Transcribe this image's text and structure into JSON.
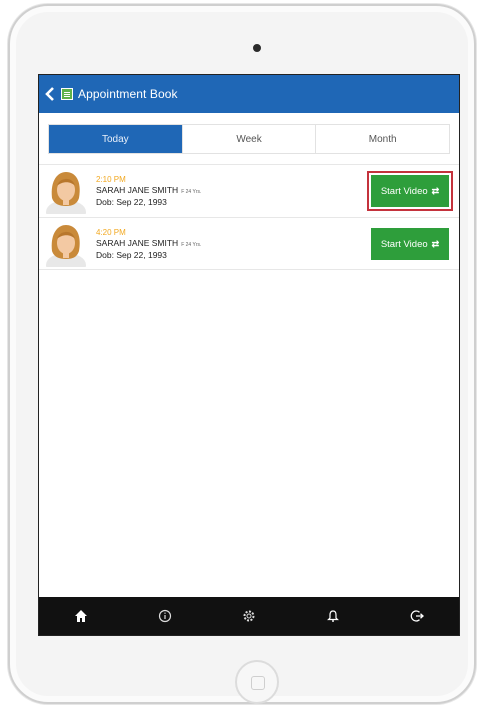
{
  "header": {
    "title": "Appointment Book",
    "back_icon": "chevron-left-icon",
    "logo_icon": "app-logo-icon"
  },
  "tabs": [
    {
      "label": "Today",
      "active": true
    },
    {
      "label": "Week",
      "active": false
    },
    {
      "label": "Month",
      "active": false
    }
  ],
  "appointments": [
    {
      "time": "2:10 PM",
      "name": "SARAH JANE SMITH",
      "meta": "F 24 Yrs.",
      "dob": "Dob: Sep 22, 1993",
      "button_label": "Start Video",
      "button_icon": "swap-arrows-icon",
      "highlighted": true
    },
    {
      "time": "4:20 PM",
      "name": "SARAH JANE SMITH",
      "meta": "F 24 Yrs.",
      "dob": "Dob: Sep 22, 1993",
      "button_label": "Start Video",
      "button_icon": "swap-arrows-icon",
      "highlighted": false
    }
  ],
  "bottom_nav": [
    {
      "icon": "home-icon"
    },
    {
      "icon": "info-icon"
    },
    {
      "icon": "settings-icon"
    },
    {
      "icon": "bell-icon"
    },
    {
      "icon": "logout-icon"
    }
  ],
  "colors": {
    "header": "#1f67b6",
    "button": "#2e9e3b",
    "time": "#f2a922",
    "highlight": "#c4323c",
    "nav": "#111111"
  }
}
